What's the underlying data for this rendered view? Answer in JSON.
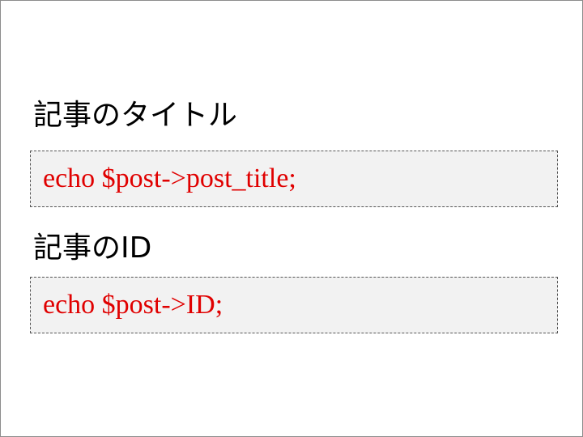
{
  "sections": [
    {
      "heading": "記事のタイトル",
      "code": "echo $post->post_title;"
    },
    {
      "heading": "記事のID",
      "code": "echo $post->ID;"
    }
  ],
  "colors": {
    "heading_text": "#000000",
    "code_text": "#e00000",
    "code_background": "#f2f2f2",
    "code_border": "#555555",
    "frame_border": "#8c8c8c"
  }
}
